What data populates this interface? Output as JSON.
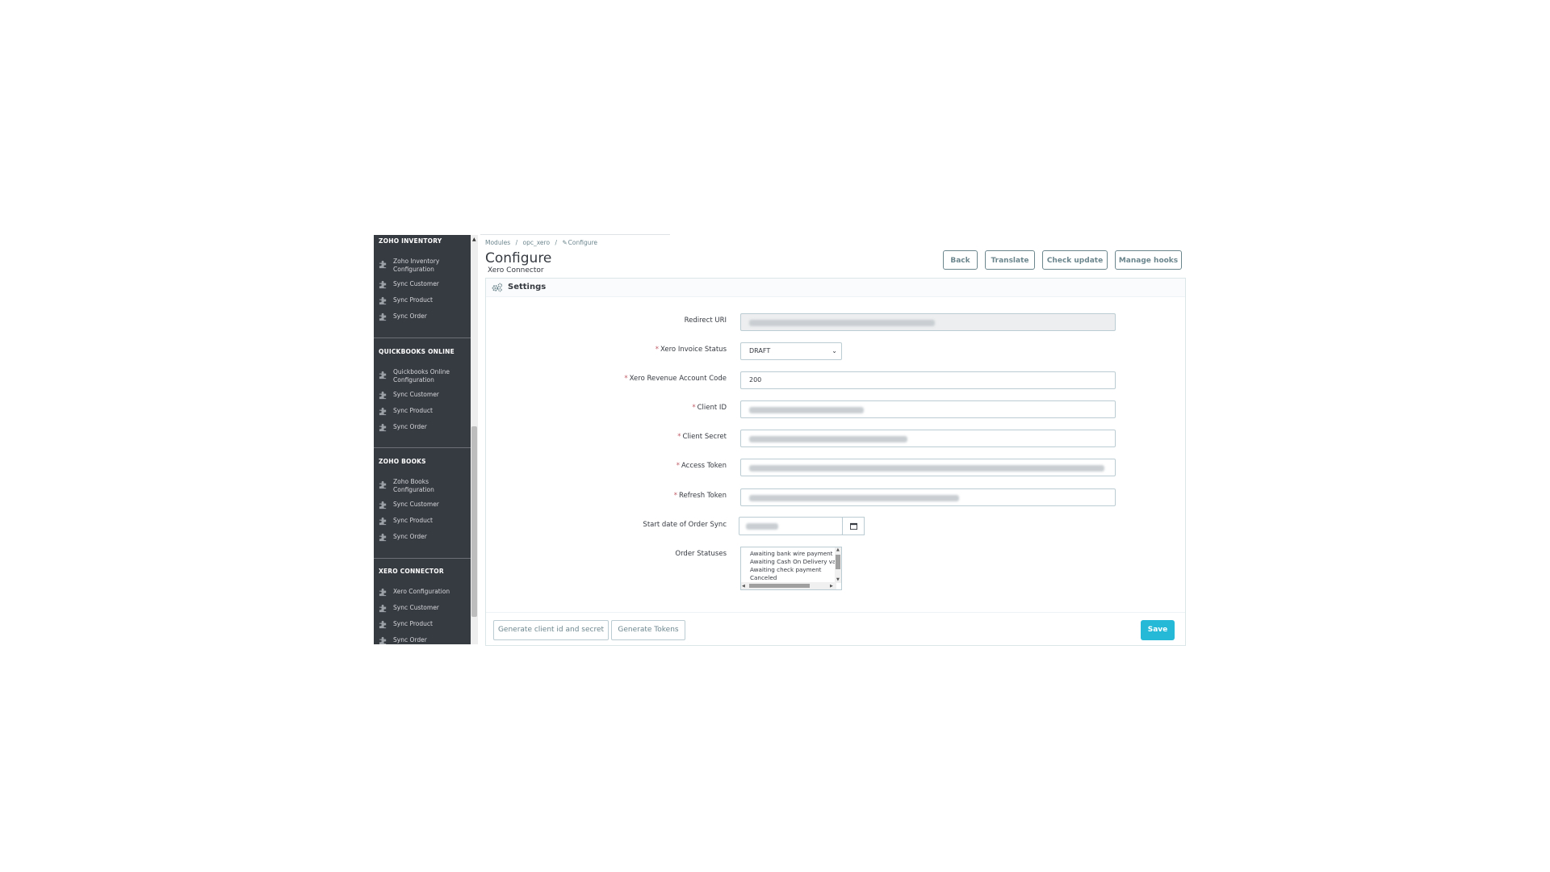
{
  "sidebar": {
    "sections": [
      {
        "title": "ZOHO INVENTORY",
        "items": [
          "Zoho Inventory Configuration",
          "Sync Customer",
          "Sync Product",
          "Sync Order"
        ]
      },
      {
        "title": "QUICKBOOKS ONLINE",
        "items": [
          "Quickbooks Online Configuration",
          "Sync Customer",
          "Sync Product",
          "Sync Order"
        ]
      },
      {
        "title": "ZOHO BOOKS",
        "items": [
          "Zoho Books Configuration",
          "Sync Customer",
          "Sync Product",
          "Sync Order"
        ]
      },
      {
        "title": "XERO CONNECTOR",
        "items": [
          "Xero Configuration",
          "Sync Customer",
          "Sync Product",
          "Sync Order"
        ]
      }
    ]
  },
  "breadcrumb": {
    "items": [
      "Modules",
      "/",
      "opc_xero",
      "/",
      "Configure"
    ]
  },
  "header": {
    "title": "Configure",
    "subtitle": "Xero Connector",
    "buttons": {
      "back": "Back",
      "translate": "Translate",
      "check_update": "Check update",
      "manage_hooks": "Manage hooks"
    }
  },
  "panel": {
    "title": "Settings",
    "fields": {
      "redirect_uri": {
        "label": "Redirect URI"
      },
      "invoice_status": {
        "label": "Xero Invoice Status",
        "value": "DRAFT"
      },
      "revenue_account": {
        "label": "Xero Revenue Account Code",
        "value": "200"
      },
      "client_id": {
        "label": "Client ID"
      },
      "client_secret": {
        "label": "Client Secret"
      },
      "access_token": {
        "label": "Access Token"
      },
      "refresh_token": {
        "label": "Refresh Token"
      },
      "start_date": {
        "label": "Start date of Order Sync"
      },
      "order_statuses": {
        "label": "Order Statuses",
        "options": [
          "Awaiting bank wire payment",
          "Awaiting Cash On Delivery validation",
          "Awaiting check payment",
          "Canceled"
        ]
      }
    },
    "required_mark": "*",
    "footer": {
      "generate_client": "Generate client id and secret",
      "generate_tokens": "Generate Tokens",
      "save": "Save"
    }
  },
  "colors": {
    "sidebar_bg": "#363a41",
    "primary": "#25b9d7",
    "required": "#c05c67"
  }
}
